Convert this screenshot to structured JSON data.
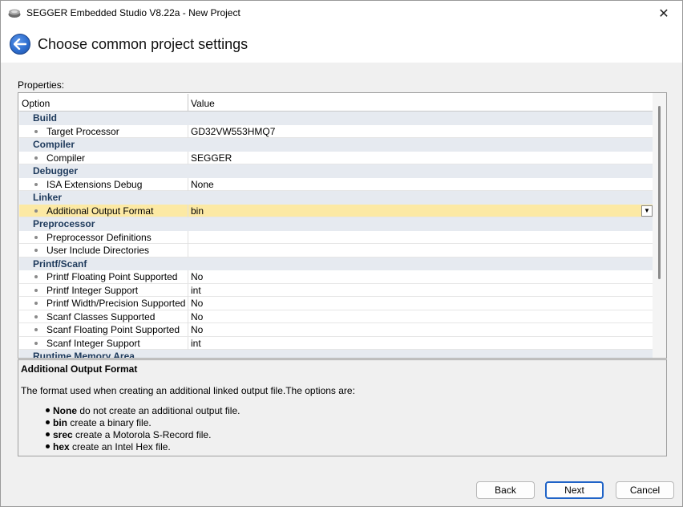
{
  "window": {
    "title": "SEGGER Embedded Studio V8.22a - New Project",
    "close_symbol": "✕"
  },
  "header": {
    "title": "Choose common project settings"
  },
  "properties_label": "Properties:",
  "grid": {
    "columns": {
      "option": "Option",
      "value": "Value"
    },
    "rows": [
      {
        "type": "category",
        "label": "Build"
      },
      {
        "type": "item",
        "option": "Target Processor",
        "value": "GD32VW553HMQ7"
      },
      {
        "type": "category",
        "label": "Compiler"
      },
      {
        "type": "item",
        "option": "Compiler",
        "value": "SEGGER"
      },
      {
        "type": "category",
        "label": "Debugger"
      },
      {
        "type": "item",
        "option": "ISA Extensions Debug",
        "value": "None"
      },
      {
        "type": "category",
        "label": "Linker"
      },
      {
        "type": "item",
        "option": "Additional Output Format",
        "value": "bin",
        "selected": true
      },
      {
        "type": "category",
        "label": "Preprocessor"
      },
      {
        "type": "item",
        "option": "Preprocessor Definitions",
        "value": ""
      },
      {
        "type": "item",
        "option": "User Include Directories",
        "value": ""
      },
      {
        "type": "category",
        "label": "Printf/Scanf"
      },
      {
        "type": "item",
        "option": "Printf Floating Point Supported",
        "value": "No"
      },
      {
        "type": "item",
        "option": "Printf Integer Support",
        "value": "int"
      },
      {
        "type": "item",
        "option": "Printf Width/Precision Supported",
        "value": "No"
      },
      {
        "type": "item",
        "option": "Scanf Classes Supported",
        "value": "No"
      },
      {
        "type": "item",
        "option": "Scanf Floating Point Supported",
        "value": "No"
      },
      {
        "type": "item",
        "option": "Scanf Integer Support",
        "value": "int"
      },
      {
        "type": "category",
        "label": "Runtime Memory Area"
      }
    ]
  },
  "description": {
    "title": "Additional Output Format",
    "text": "The format used when creating an additional linked output file.The options are:",
    "options": [
      {
        "key": "None",
        "text": " do not create an additional output file."
      },
      {
        "key": "bin",
        "text": " create a binary file."
      },
      {
        "key": "srec",
        "text": " create a Motorola S-Record file."
      },
      {
        "key": "hex",
        "text": " create an Intel Hex file."
      }
    ]
  },
  "buttons": {
    "back": "Back",
    "next": "Next",
    "cancel": "Cancel"
  },
  "colors": {
    "selected_row": "#fce9a4",
    "category_row": "#e6eaf0",
    "primary_border": "#1f63c7",
    "back_icon": "#2f6fd0"
  },
  "icons": {
    "app": "segger-app-icon",
    "back": "back-arrow-icon",
    "close": "close-icon",
    "dropdown": "chevron-down-icon"
  }
}
